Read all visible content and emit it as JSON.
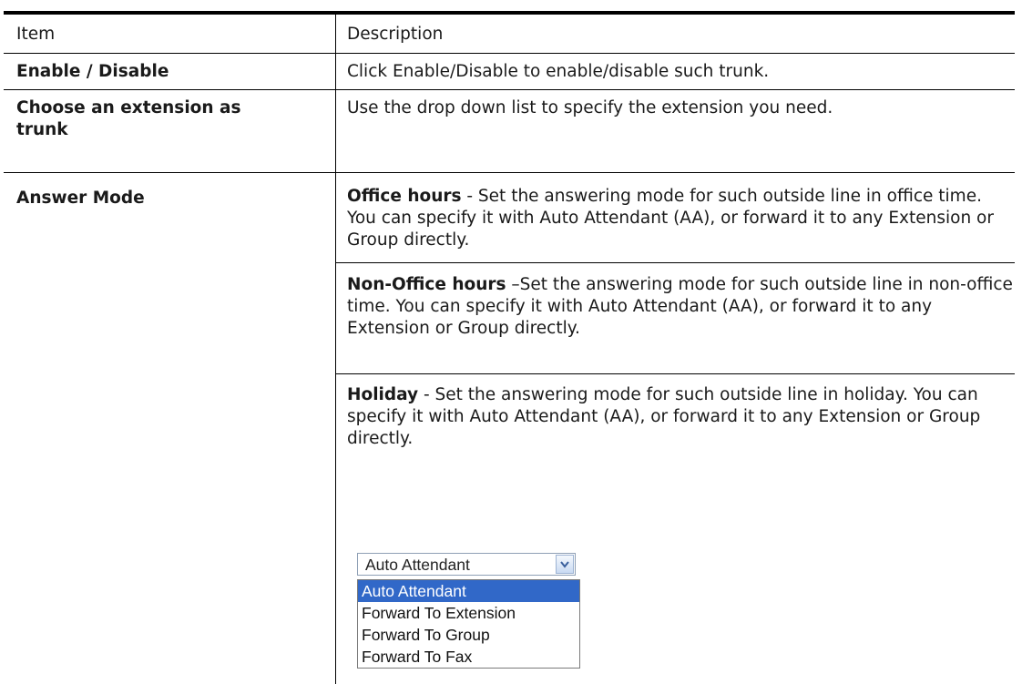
{
  "table": {
    "headers": {
      "item": "Item",
      "description": "Description"
    },
    "rows": [
      {
        "item": "Enable / Disable",
        "description": "Click Enable/Disable to enable/disable such trunk."
      },
      {
        "item": "Choose an extension as trunk",
        "description": "Use the drop down list to specify the extension you need."
      },
      {
        "item": "Answer Mode",
        "paragraphs": [
          {
            "term": "Office hours",
            "text": " - Set the answering mode for such outside line in office time. You can specify it with Auto Attendant (AA), or forward it to any Extension or Group directly."
          },
          {
            "term": "Non-Office hours",
            "text": " –Set the answering mode for such outside line in non-office time. You can specify it with Auto Attendant (AA), or forward it to any Extension or Group directly."
          },
          {
            "term": "Holiday",
            "text": " - Set the answering mode for such outside line in holiday. You can specify it with Auto Attendant (AA), or forward it to any Extension or Group directly."
          }
        ]
      }
    ]
  },
  "dropdown": {
    "selected_value": "Auto Attendant",
    "options": [
      "Auto Attendant",
      "Forward To Extension",
      "Forward To Group",
      "Forward To Fax"
    ],
    "highlighted_index": 0
  }
}
